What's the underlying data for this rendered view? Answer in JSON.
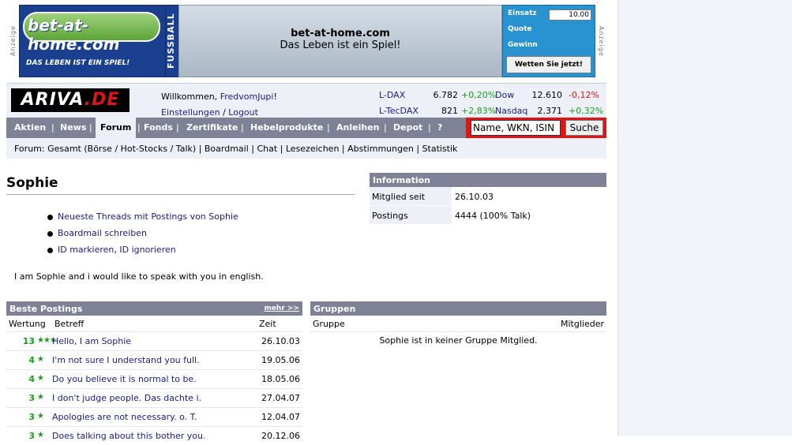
{
  "banner": {
    "anzeige_label": "Anzeige",
    "brand": "bet-at-home.com",
    "slogan": "DAS LEBEN IST EIN SPIEL!",
    "side_label": "FUSSBALL",
    "center_title": "bet-at-home.com",
    "center_subtitle": "Das Leben ist ein Spiel!",
    "einsatz_label": "Einsatz",
    "einsatz_value": "10.00",
    "quote_label": "Quote",
    "gewinn_label": "Gewinn",
    "bet_button": "Wetten Sie jetzt!"
  },
  "header": {
    "logo_main": "ARIVA",
    "logo_suffix": ".DE",
    "welcome_prefix": "Willkommen, ",
    "username": "FredvomJupi",
    "welcome_suffix": "!",
    "settings_link": "Einstellungen",
    "logout_link": "Logout",
    "link_separator": " / ",
    "quotes": [
      {
        "name": "L-DAX",
        "value": "6.782",
        "change": "+0,20%"
      },
      {
        "name": "Dow",
        "value": "12.610",
        "change": "-0,12%"
      },
      {
        "name": "L-TecDAX",
        "value": "821",
        "change": "+2,83%"
      },
      {
        "name": "Nasdaq",
        "value": "2.371",
        "change": "+0,32%"
      }
    ]
  },
  "nav": {
    "items": [
      "Aktien",
      "News",
      "Forum",
      "Fonds",
      "Zertifikate",
      "Hebelprodukte",
      "Anleihen",
      "Depot",
      "?"
    ],
    "active": "Forum",
    "separator": "|",
    "search_value": "Name, WKN, ISIN",
    "search_button": "Suche"
  },
  "subnav": {
    "text": "Forum: Gesamt (Börse / Hot-Stocks / Talk) | Boardmail | Chat | Lesezeichen | Abstimmungen | Statistik"
  },
  "profile": {
    "name": "Sophie",
    "links": {
      "threads": "Neueste Threads mit Postings von Sophie",
      "boardmail": "Boardmail schreiben",
      "mark": "ID markieren",
      "comma": ", ",
      "ignore": "ID ignorieren"
    },
    "about": "I am Sophie and i would like to speak with you in english."
  },
  "info": {
    "title": "Information",
    "member_since_label": "Mitglied seit",
    "member_since_value": "26.10.03",
    "postings_label": "Postings",
    "postings_value": "4444 (100% Talk)"
  },
  "postings": {
    "title": "Beste Postings",
    "more_link": "mehr >>",
    "col_rating": "Wertung",
    "col_subject": "Betreff",
    "col_time": "Zeit",
    "rows": [
      {
        "rating": "13",
        "stars": "★★★",
        "subject": "Hello, I am Sophie",
        "date": "26.10.03"
      },
      {
        "rating": "4",
        "stars": "★",
        "subject": "I'm not sure I understand you full.",
        "date": "19.05.06"
      },
      {
        "rating": "4",
        "stars": "★",
        "subject": "Do you believe it is normal to be.",
        "date": "18.05.06"
      },
      {
        "rating": "3",
        "stars": "★",
        "subject": "I don't judge people. Das dachte i.",
        "date": "27.04.07"
      },
      {
        "rating": "3",
        "stars": "★",
        "subject": "Apologies are not necessary. o. T.",
        "date": "12.04.07"
      },
      {
        "rating": "3",
        "stars": "★",
        "subject": "Does talking about this bother you.",
        "date": "20.12.06"
      }
    ]
  },
  "groups": {
    "title": "Gruppen",
    "col_group": "Gruppe",
    "col_members": "Mitglieder",
    "message": "Sophie ist in keiner Gruppe Mitglied."
  }
}
